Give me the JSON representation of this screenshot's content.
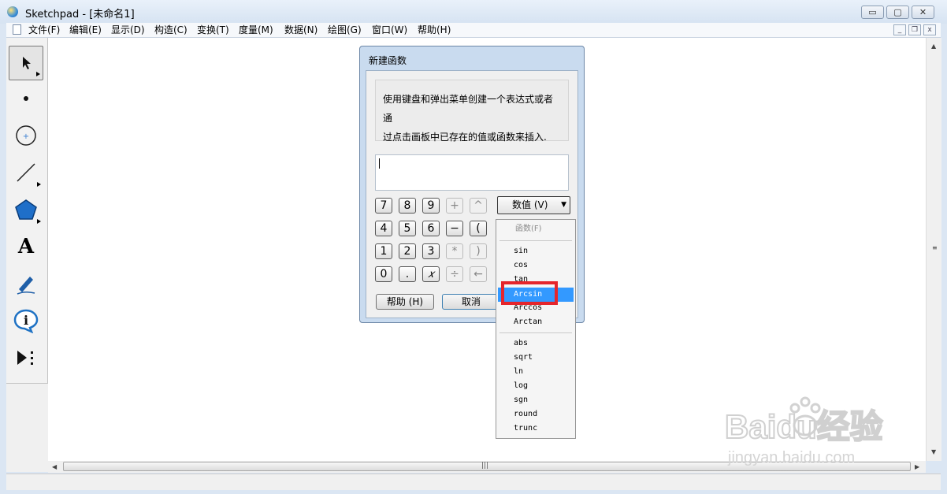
{
  "window": {
    "title": "Sketchpad  - [未命名1]",
    "btn_min": "▭",
    "btn_max": "▢",
    "btn_close": "✕"
  },
  "menubar": {
    "items": [
      "文件(F)",
      "编辑(E)",
      "显示(D)",
      "构造(C)",
      "变换(T)",
      "度量(M)",
      "数据(N)",
      "绘图(G)",
      "窗口(W)",
      "帮助(H)"
    ]
  },
  "toolbox": {
    "tools": [
      "selection-arrow",
      "point",
      "compass",
      "straightedge",
      "polygon",
      "text",
      "marker",
      "information",
      "custom-tools"
    ],
    "text_tool_label": "A",
    "info_tool_label": "i"
  },
  "dialog": {
    "title": "新建函数",
    "instructions_line1": "使用键盘和弹出菜单创建一个表达式或者通",
    "instructions_line2": "过点击画板中已存在的值或函数来插入.",
    "keypad": [
      [
        "7",
        "8",
        "9",
        "+",
        "^"
      ],
      [
        "4",
        "5",
        "6",
        "−",
        "("
      ],
      [
        "1",
        "2",
        "3",
        "*",
        ")"
      ],
      [
        "0",
        ".",
        "𝑥",
        "÷",
        "←"
      ]
    ],
    "values_dropdown": "数值 (V)",
    "help_button": "帮助 (H)",
    "cancel_button": "取消"
  },
  "function_menu": {
    "header": "函数(F)",
    "trig": [
      "sin",
      "cos",
      "tan",
      "Arcsin",
      "Arccos",
      "Arctan"
    ],
    "other": [
      "abs",
      "sqrt",
      "ln",
      "log",
      "sgn",
      "round",
      "trunc"
    ],
    "selected": "Arcsin"
  },
  "watermark": {
    "brand": "Baidu经验",
    "url": "jingyan.baidu.com"
  },
  "colors": {
    "selection": "#3399ff",
    "highlight_box": "#e5252b",
    "title_bar": "#dbe6f3"
  }
}
